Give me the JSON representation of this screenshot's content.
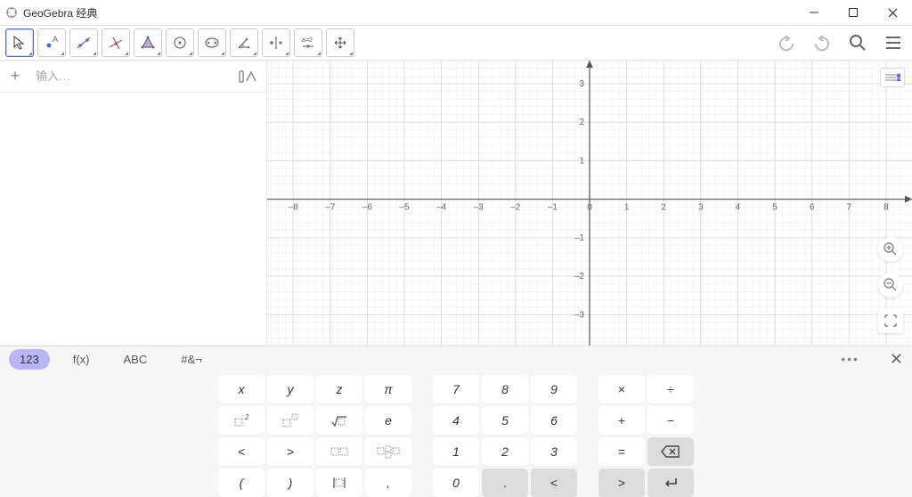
{
  "window": {
    "title": "GeoGebra 经典"
  },
  "toolbar": {
    "tools": [
      "move",
      "point",
      "line",
      "perpendicular",
      "polygon",
      "circle",
      "ellipse",
      "angle",
      "reflect",
      "slider",
      "pan"
    ]
  },
  "input": {
    "placeholder": "输入…"
  },
  "graph": {
    "x_ticks": [
      -8,
      -7,
      -6,
      -5,
      -4,
      -3,
      -2,
      -1,
      0,
      1,
      2,
      3,
      4,
      5,
      6,
      7,
      8
    ],
    "y_ticks": [
      -3,
      -2,
      -1,
      1,
      2,
      3
    ]
  },
  "keyboard": {
    "tabs": [
      "123",
      "f(x)",
      "ABC",
      "#&¬"
    ],
    "active_tab": 0,
    "rows": [
      [
        "x",
        "y",
        "z",
        "π",
        "7",
        "8",
        "9",
        "×",
        "÷"
      ],
      [
        "□²",
        "□^□",
        "√□",
        "e",
        "4",
        "5",
        "6",
        "+",
        "−"
      ],
      [
        "<",
        ">",
        "□□",
        "□□□",
        "1",
        "2",
        "3",
        "=",
        "⌫"
      ],
      [
        "(",
        ")",
        "|□|",
        ",",
        "0",
        ".",
        "<",
        ">",
        "↵"
      ]
    ]
  },
  "chart_data": {
    "type": "scatter",
    "title": "",
    "xlabel": "",
    "ylabel": "",
    "xlim": [
      -8.7,
      8.7
    ],
    "ylim": [
      -3.8,
      3.6
    ],
    "series": []
  }
}
